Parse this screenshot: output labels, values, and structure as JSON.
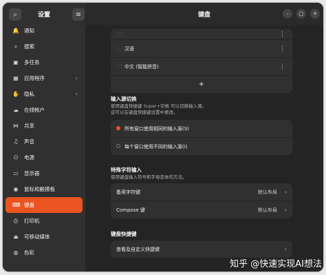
{
  "sidebar": {
    "title": "设置",
    "items": [
      {
        "icon": "bell-icon",
        "glyph": "🔔",
        "label": "通知",
        "chevron": false
      },
      {
        "icon": "search-icon",
        "glyph": "⌕",
        "label": "搜索",
        "chevron": false
      },
      {
        "icon": "multitask-icon",
        "glyph": "▣",
        "label": "多任务",
        "chevron": false
      },
      {
        "icon": "apps-icon",
        "glyph": "▦",
        "label": "应用程序",
        "chevron": true
      },
      {
        "icon": "privacy-icon",
        "glyph": "✋",
        "label": "隐私",
        "chevron": true
      },
      {
        "icon": "cloud-icon",
        "glyph": "☁",
        "label": "在线帐户",
        "chevron": false
      },
      {
        "icon": "share-icon",
        "glyph": "⋈",
        "label": "共享",
        "chevron": false
      },
      {
        "icon": "music-icon",
        "glyph": "♫",
        "label": "声音",
        "chevron": false
      },
      {
        "icon": "power-icon",
        "glyph": "⏻",
        "label": "电源",
        "chevron": false
      },
      {
        "icon": "display-icon",
        "glyph": "▭",
        "label": "显示器",
        "chevron": false
      },
      {
        "icon": "mouse-icon",
        "glyph": "◉",
        "label": "鼠标和触摸板",
        "chevron": false
      },
      {
        "icon": "keyboard-icon",
        "glyph": "⌨",
        "label": "键盘",
        "chevron": false,
        "active": true
      },
      {
        "icon": "printer-icon",
        "glyph": "⎙",
        "label": "打印机",
        "chevron": false
      },
      {
        "icon": "media-icon",
        "glyph": "⏏",
        "label": "可移动媒体",
        "chevron": false
      },
      {
        "icon": "color-icon",
        "glyph": "◍",
        "label": "色彩",
        "chevron": false
      }
    ]
  },
  "main": {
    "title": "键盘",
    "input_sources": [
      {
        "label": "汉语"
      },
      {
        "label": "中文 (智能拼音)"
      }
    ],
    "add_symbol": "+",
    "switch_section": {
      "title": "输入源切换",
      "desc_line1": "使用键盘快捷键 Super+空格 可以切换输入源。",
      "desc_line2": "这可以在键盘快捷键设置中更改。",
      "options": [
        {
          "label": "所有窗口使用相同的输入源(S)",
          "selected": true
        },
        {
          "label": "每个窗口使用不同的输入源(I)",
          "selected": false
        }
      ]
    },
    "special_section": {
      "title": "特殊字符输入",
      "desc": "使用键盘输入符号和字母变体的方法。",
      "rows": [
        {
          "label": "备用字符键",
          "value": "默认布局"
        },
        {
          "label": "Compose 键",
          "value": "默认布局"
        }
      ]
    },
    "shortcut_section": {
      "title": "键盘快捷键",
      "row": "查看及自定义快捷键"
    }
  },
  "watermark": "知乎 @快速实现AI想法"
}
